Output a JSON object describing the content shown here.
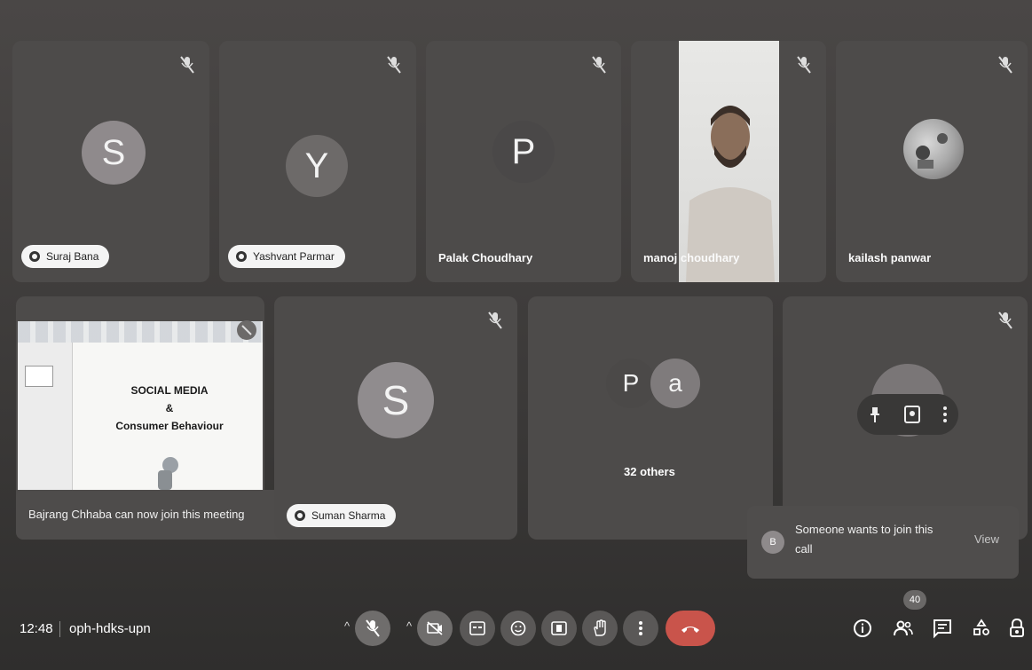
{
  "tiles": [
    {
      "initial": "S",
      "name": "Suraj Bana",
      "pill": true
    },
    {
      "initial": "Y",
      "name": "Yashvant Parmar",
      "pill": true
    },
    {
      "initial": "P",
      "name": "Palak Choudhary",
      "pill": false
    },
    {
      "name": "manoj choudhary",
      "pill": false
    },
    {
      "name": "kailash panwar",
      "pill": false
    },
    {
      "initial": "S",
      "name": "Suman Sharma",
      "pill": true
    }
  ],
  "presentation": {
    "line1": "SOCIAL MEDIA",
    "line2": "&",
    "line3": "Consumer Behaviour"
  },
  "group_tile": {
    "initial_1": "P",
    "initial_2": "a",
    "others_label": "32 others"
  },
  "toasts": {
    "join_notice": "Bajrang Chhaba can now join this meeting",
    "request_avatar": "B",
    "request_line1": "Someone wants to join this",
    "request_line2": "call",
    "request_action": "View"
  },
  "bottom_bar": {
    "time": "12:48",
    "meeting_code": "oph-hdks-upn",
    "participant_count": "40"
  },
  "colors": {
    "end_call": "#c9544b",
    "tile_bg": "#4d4b4a",
    "avatar_s": "#8f8a8c",
    "avatar_y": "#6d6a69"
  }
}
